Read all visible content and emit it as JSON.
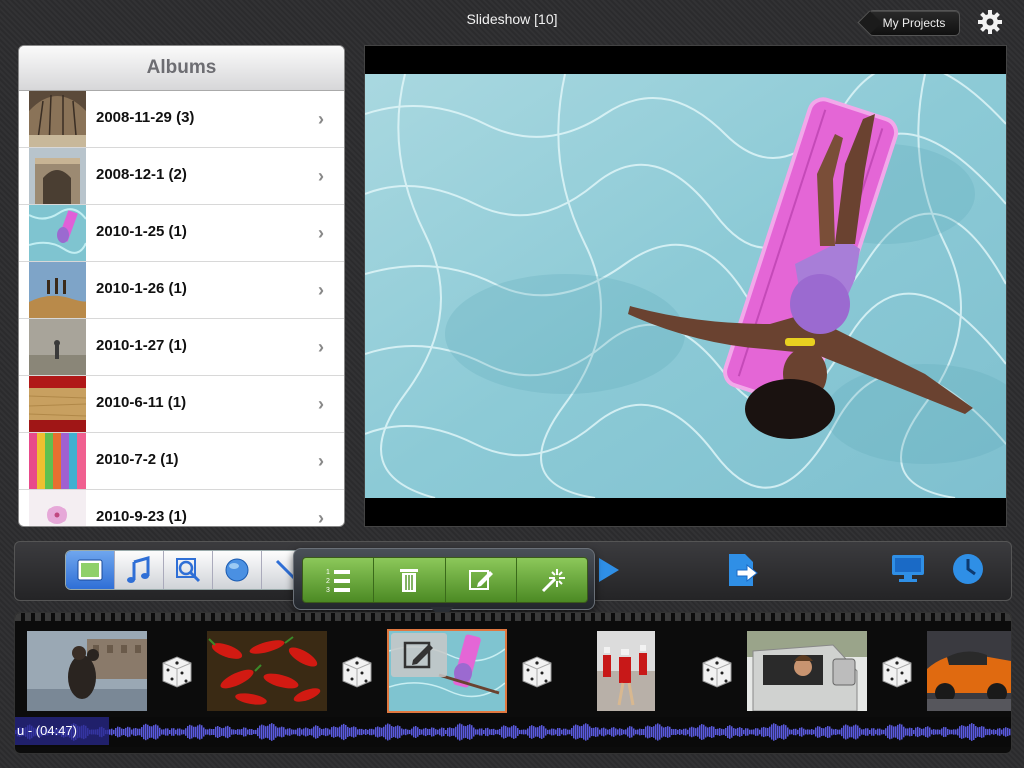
{
  "header": {
    "title": "Slideshow  [10]",
    "my_projects_label": "My Projects",
    "settings_icon": "gear-icon"
  },
  "albums": {
    "title": "Albums",
    "items": [
      {
        "label": "2008-11-29 (3)"
      },
      {
        "label": "2008-12-1 (2)"
      },
      {
        "label": "2010-1-25 (1)"
      },
      {
        "label": "2010-1-26 (1)"
      },
      {
        "label": "2010-1-27 (1)"
      },
      {
        "label": "2010-6-11 (1)"
      },
      {
        "label": "2010-7-2 (1)"
      },
      {
        "label": "2010-9-23 (1)"
      }
    ]
  },
  "toolbar": {
    "tabs": [
      "photo-icon",
      "music-note-icon",
      "zoom-icon",
      "globe-icon",
      "text-icon"
    ],
    "right_icons": [
      "play-icon",
      "export-icon",
      "tv-icon",
      "clock-icon"
    ],
    "popup_actions": [
      "numbered-list-icon",
      "trash-icon",
      "pencil-icon",
      "magic-wand-icon"
    ]
  },
  "timeline": {
    "music_label": "u - (04:47)",
    "clips": [
      "couple-photo",
      "chili-peppers-photo",
      "pool-photo",
      "parade-photo",
      "car-window-photo",
      "orange-car-photo"
    ]
  },
  "colors": {
    "accent": "#2f6fd6",
    "popup_green": "#6aaa3a",
    "selection": "#e07840",
    "wave": "#5a5adf"
  }
}
